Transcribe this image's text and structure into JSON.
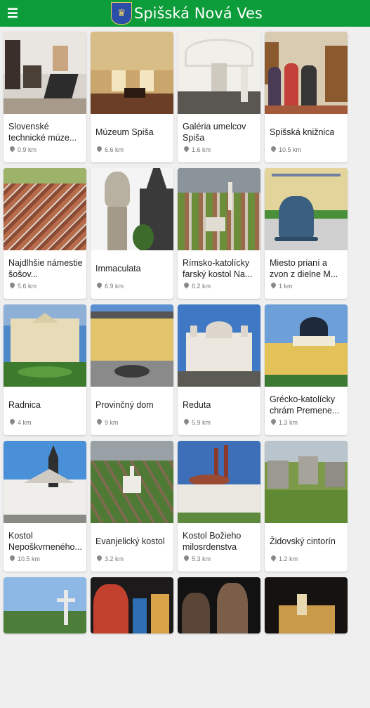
{
  "header": {
    "menu_icon": "menu-icon",
    "crest_icon": "coat-of-arms-icon",
    "title": "Spišská Nová Ves",
    "color": "#0d9c3a"
  },
  "places": [
    {
      "name": "Slovenské technické múze...",
      "distance": "0.9 km"
    },
    {
      "name": "Múzeum Spiša",
      "distance": "6.6 km"
    },
    {
      "name": "Galéria umelcov Spiša",
      "distance": "1.6 km"
    },
    {
      "name": "Spišská knižnica",
      "distance": "10.5 km"
    },
    {
      "name": "Najdlhšie námestie šošov...",
      "distance": "5.6 km"
    },
    {
      "name": "Immaculata",
      "distance": "6.9 km"
    },
    {
      "name": "Rímsko-katolícky farský kostol Na...",
      "distance": "6.2 km"
    },
    {
      "name": "Miesto prianí a zvon z dielne M...",
      "distance": "1 km"
    },
    {
      "name": "Radnica",
      "distance": "4 km"
    },
    {
      "name": "Provinčný dom",
      "distance": "9 km"
    },
    {
      "name": "Reduta",
      "distance": "5.9 km"
    },
    {
      "name": "Grécko-katolícky chrám Premene...",
      "distance": "1.3 km"
    },
    {
      "name": "Kostol Nepoškvrneného...",
      "distance": "10.5 km"
    },
    {
      "name": "Evanjelický kostol",
      "distance": "3.2 km"
    },
    {
      "name": "Kostol Božieho milosrdenstva",
      "distance": "5.3 km"
    },
    {
      "name": "Židovský cintorín",
      "distance": "1.2 km"
    }
  ]
}
